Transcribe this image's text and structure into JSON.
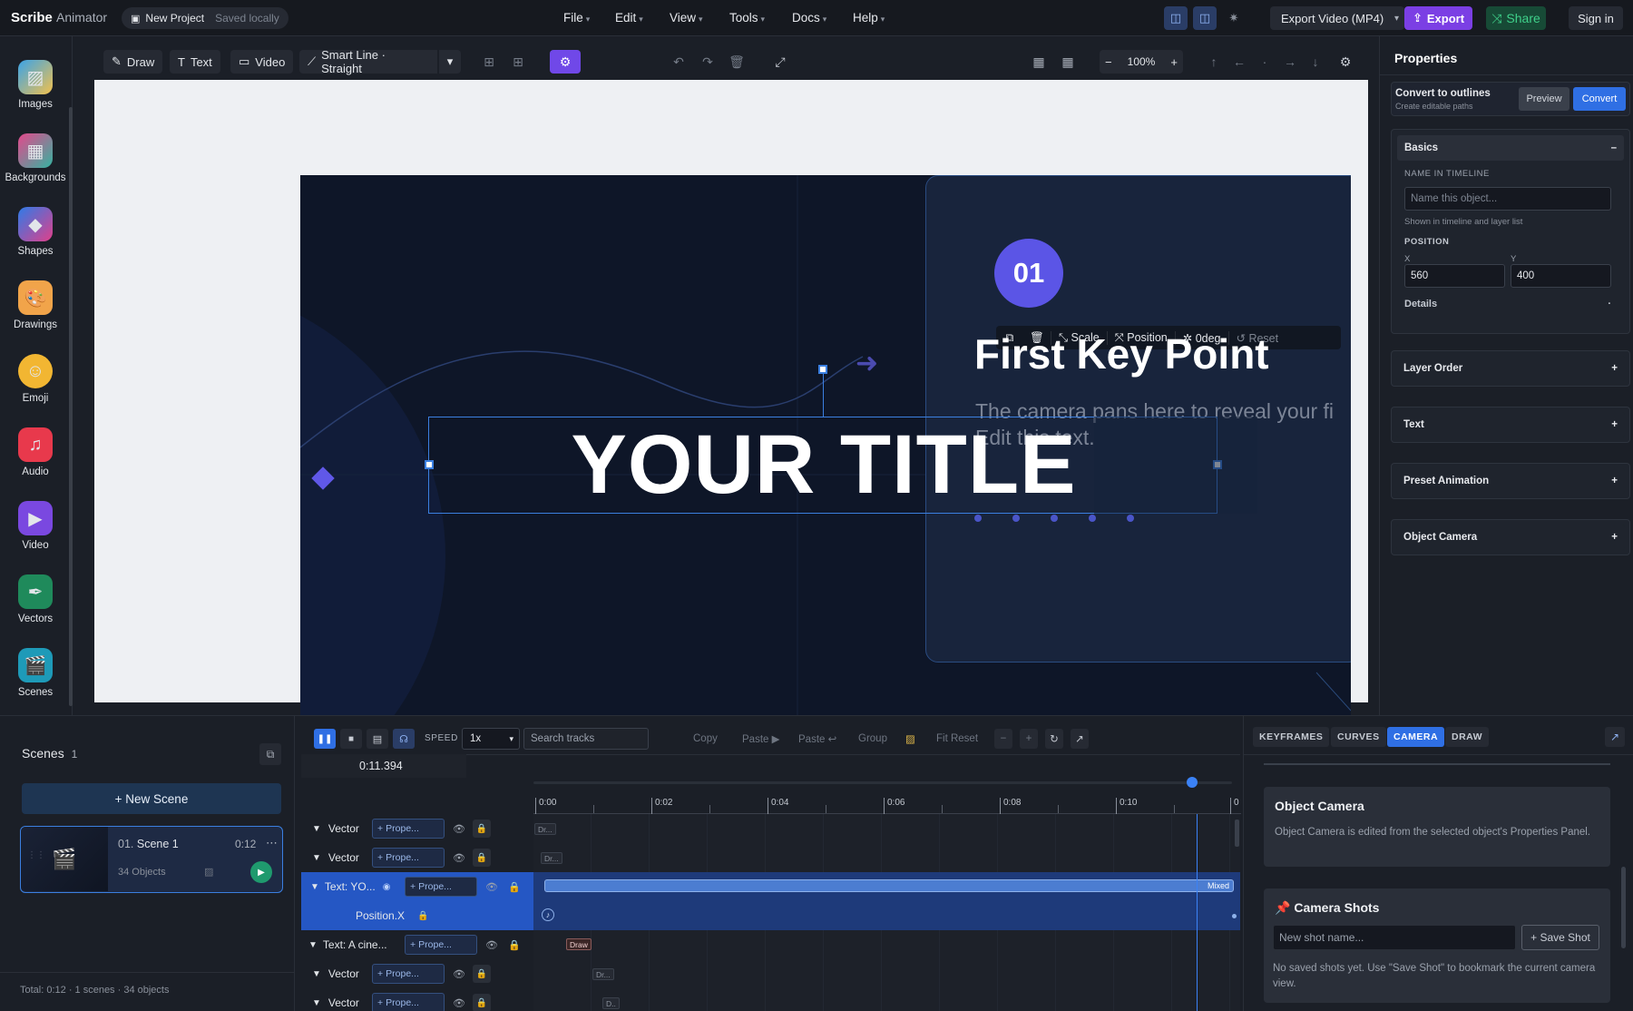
{
  "app": {
    "brand": "Scribe",
    "brand_sub": "Animator",
    "project": "New Project",
    "save_state": "Saved locally"
  },
  "menu": [
    "File",
    "Edit",
    "View",
    "Tools",
    "Docs",
    "Help"
  ],
  "top_right": {
    "export_select": "Export Video (MP4)",
    "export": "Export",
    "share": "Share",
    "signin": "Sign in"
  },
  "tools": [
    "Images",
    "Backgrounds",
    "Shapes",
    "Drawings",
    "Emoji",
    "Audio",
    "Video",
    "Vectors",
    "Scenes"
  ],
  "canvas_toolbar": {
    "draw": "Draw",
    "text": "Text",
    "video": "Video",
    "smart_line": "Smart Line · Straight",
    "zoom": "100%"
  },
  "slide": {
    "badge": "01",
    "heading": "First Key Point",
    "body_line1": "The camera pans here to reveal your fi",
    "body_line2": "Edit this text.",
    "title": "YOUR TITLE",
    "float_toolbar": {
      "scale": "Scale",
      "position": "Position",
      "rotation": "0deg",
      "reset": "Reset"
    }
  },
  "properties": {
    "title": "Properties",
    "convert_title": "Convert to outlines",
    "convert_sub": "Create editable paths",
    "preview": "Preview",
    "convert": "Convert",
    "basics": "Basics",
    "name_label": "NAME IN TIMELINE",
    "name_placeholder": "Name this object...",
    "name_hint": "Shown in timeline and layer list",
    "position_label": "POSITION",
    "x_label": "X",
    "y_label": "Y",
    "x": "560",
    "y": "400",
    "details": "Details",
    "sections": [
      "Layer Order",
      "Text",
      "Preset Animation",
      "Object Camera"
    ]
  },
  "scenes": {
    "title": "Scenes",
    "count": "1",
    "new_scene": "+ New Scene",
    "scene_index": "01.",
    "scene_name": "Scene 1",
    "scene_duration": "0:12",
    "scene_objects": "34 Objects",
    "footer": "Total: 0:12 · 1 scenes · 34 objects"
  },
  "timeline": {
    "speed_label": "SPEED",
    "speed": "1x",
    "search_placeholder": "Search tracks",
    "copy": "Copy",
    "paste": "Paste ▶",
    "paste2": "Paste ↩",
    "group": "Group",
    "fit_reset": "Fit Reset",
    "time": "0:11.394",
    "ruler": [
      "0:00",
      "0:02",
      "0:04",
      "0:06",
      "0:08",
      "0:10",
      "0"
    ],
    "tracks": [
      {
        "name": "Vector",
        "prop": "Prope...",
        "chip": "Dr..."
      },
      {
        "name": "Vector",
        "prop": "Prope...",
        "chip": "Dr..."
      },
      {
        "name": "Text: YO...",
        "prop": "Prope...",
        "chip": "Mixed"
      },
      {
        "name": "Position.X",
        "prop": "",
        "chip": ""
      },
      {
        "name": "Text: A cine...",
        "prop": "Prope...",
        "chip": "Draw"
      },
      {
        "name": "Vector",
        "prop": "Prope...",
        "chip": "Dr..."
      },
      {
        "name": "Vector",
        "prop": "Prope...",
        "chip": "D.."
      }
    ]
  },
  "side_tabs": [
    "KEYFRAMES",
    "CURVES",
    "CAMERA",
    "DRAW"
  ],
  "camera_panel": {
    "object_camera_title": "Object Camera",
    "object_camera_text": "Object Camera is edited from the selected object's Properties Panel.",
    "shots_title": "Camera Shots",
    "shot_placeholder": "New shot name...",
    "save_shot": "+ Save Shot",
    "empty_text": "No saved shots yet. Use \"Save Shot\" to bookmark the current camera view."
  },
  "colors": {
    "accent": "#2f6fe4",
    "purple": "#6b5cf0",
    "share_green": "#1fa36b",
    "export_purple": "#7b3fe4"
  }
}
